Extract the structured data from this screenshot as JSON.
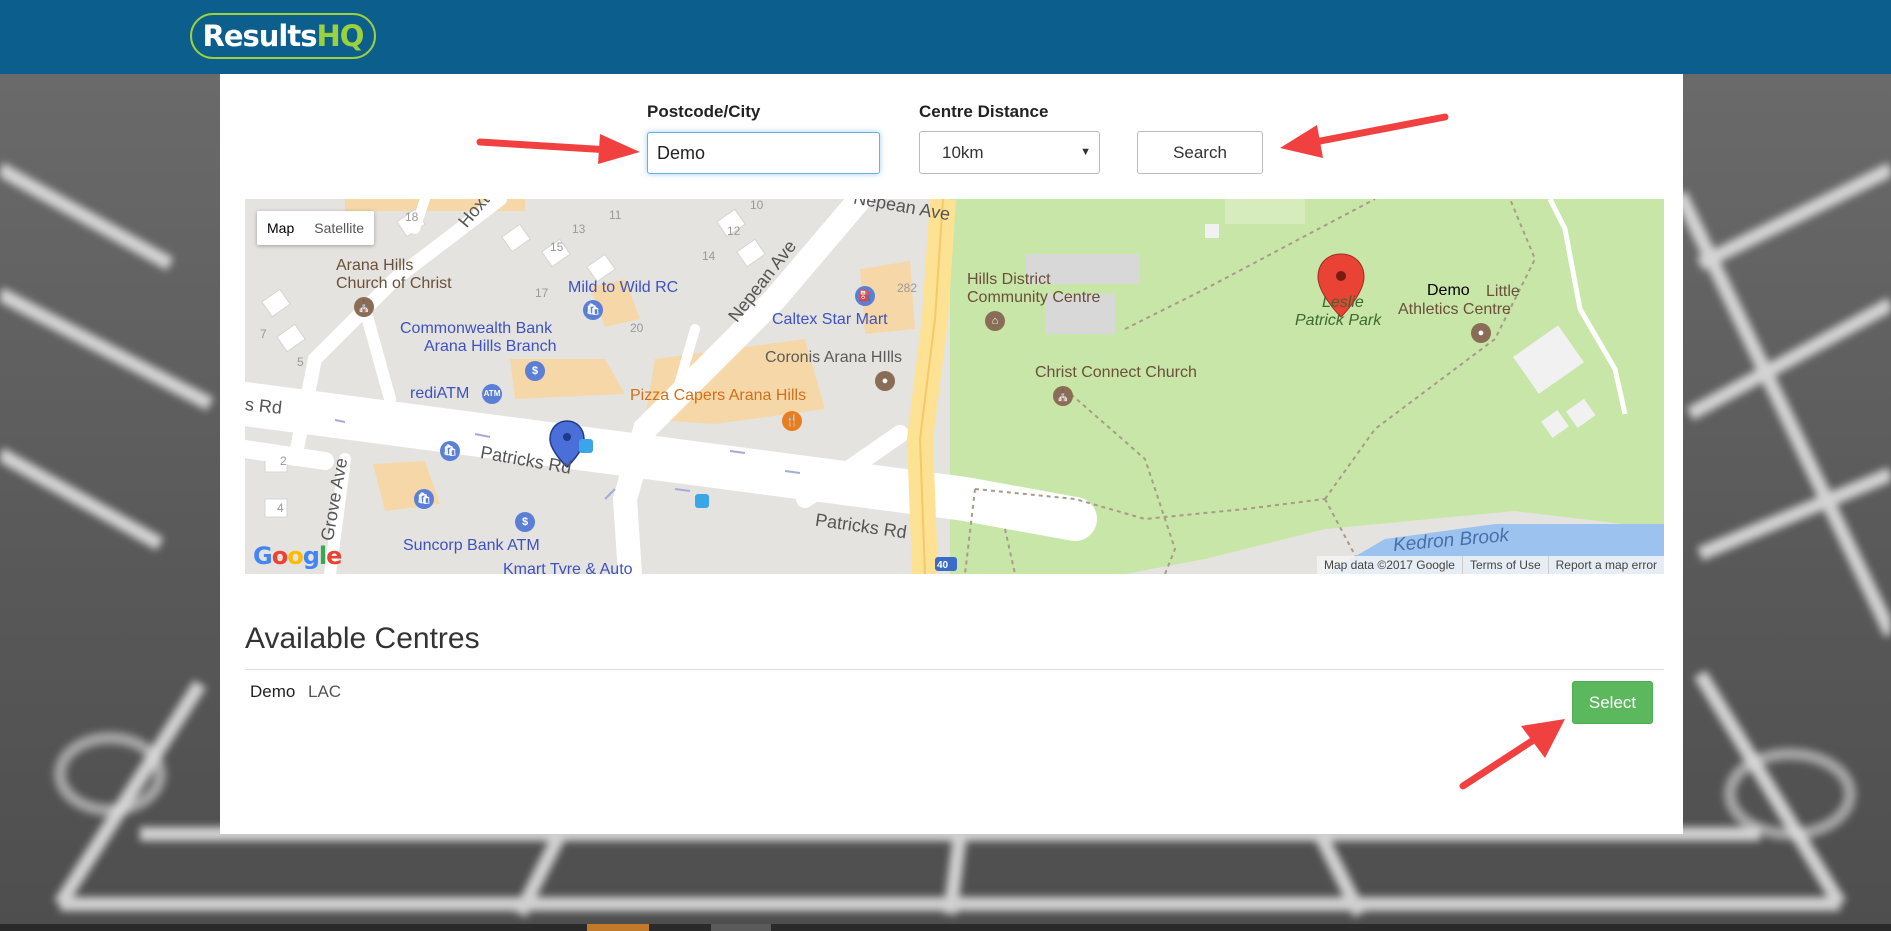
{
  "header": {
    "logo_part1": "Results",
    "logo_part2": "HQ",
    "brand_color": "#0c5f8d",
    "logo_accent": "#9bd13d"
  },
  "search": {
    "postcode_label": "Postcode/City",
    "postcode_value": "Demo",
    "distance_label": "Centre Distance",
    "distance_value": "10km",
    "search_button": "Search"
  },
  "map": {
    "type_map": "Map",
    "type_satellite": "Satellite",
    "marker_label": "Demo",
    "places": {
      "church_1": "Arana Hills",
      "church_2": "Church of Christ",
      "hoxton": "Hoxton St",
      "nepean_top": "Nepean Ave",
      "nepean_diag": "Nepean Ave",
      "mild": "Mild to Wild RC",
      "caltex": "Caltex Star Mart",
      "cba_1": "Commonwealth Bank",
      "cba_2": "Arana Hills Branch",
      "coronis": "Coronis Arana HIlls",
      "redi": "rediATM",
      "pizza": "Pizza Capers Arana Hills",
      "patricks_left": "s Rd",
      "patricks_1": "Patricks Rd",
      "patricks_2": "Patricks Rd",
      "grove": "Grove Ave",
      "suncorp": "Suncorp Bank ATM",
      "kmart": "Kmart Tyre & Auto",
      "hills_1": "Hills District",
      "hills_2": "Community Centre",
      "christ_connect": "Christ Connect Church",
      "leslie_1": "Leslie",
      "leslie_2": "Patrick Park",
      "lac_1": "Little",
      "lac_2": "Athletics Centre",
      "kedron": "Kedron Brook",
      "route": "40"
    },
    "house_numbers": [
      "18",
      "13",
      "11",
      "10",
      "15",
      "12",
      "14",
      "17",
      "282",
      "20",
      "7",
      "5",
      "2",
      "4"
    ],
    "poi_icons": {
      "atm": "ATM",
      "bank": "$",
      "fuel": "⛽",
      "food": "🍴"
    },
    "credits": [
      "Map data ©2017 Google",
      "Terms of Use",
      "Report a map error"
    ],
    "google_logo": [
      "G",
      "o",
      "o",
      "g",
      "l",
      "e"
    ]
  },
  "centres": {
    "title": "Available Centres",
    "items": [
      {
        "name": "Demo",
        "code": "LAC",
        "select_label": "Select"
      }
    ]
  },
  "colors": {
    "select_button": "#5cb85c",
    "annotation_arrow": "#f04040"
  }
}
